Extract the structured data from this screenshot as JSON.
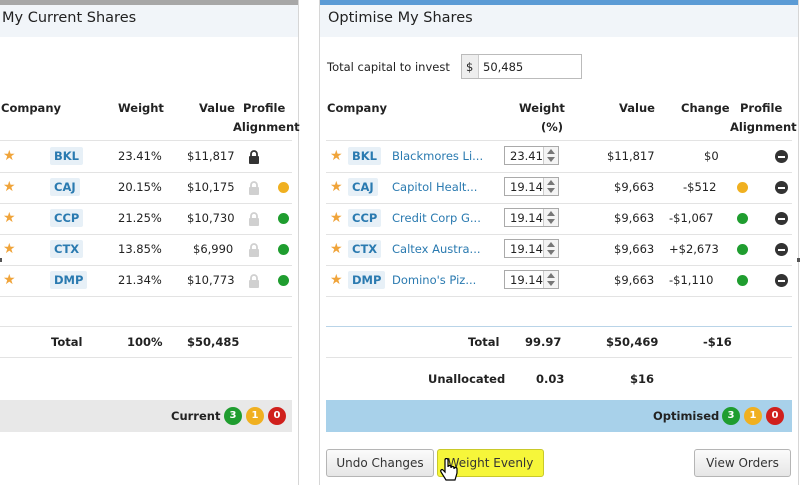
{
  "colors": {
    "green": "#1f9d2f",
    "amber": "#f0b020",
    "red": "#d0201c",
    "star": "#f0a43a",
    "link": "#2a7ab0",
    "summary_bar": "#a8d1ea"
  },
  "current": {
    "title": "My Current Shares",
    "headers": {
      "company": "Company",
      "weight": "Weight",
      "value": "Value",
      "profile1": "Profile",
      "profile2": "Alignment"
    },
    "rows": [
      {
        "code": "BKL",
        "weight": "23.41%",
        "value": "$11,817",
        "lock": "dark",
        "status": "none"
      },
      {
        "code": "CAJ",
        "weight": "20.15%",
        "value": "$10,175",
        "lock": "light",
        "status": "amber"
      },
      {
        "code": "CCP",
        "weight": "21.25%",
        "value": "$10,730",
        "lock": "light",
        "status": "green"
      },
      {
        "code": "CTX",
        "weight": "13.85%",
        "value": "$6,990",
        "lock": "light",
        "status": "green"
      },
      {
        "code": "DMP",
        "weight": "21.34%",
        "value": "$10,773",
        "lock": "light",
        "status": "green"
      }
    ],
    "total": {
      "label": "Total",
      "weight": "100%",
      "value": "$50,485"
    },
    "summary": {
      "label": "Current",
      "green": "3",
      "amber": "1",
      "red": "0"
    }
  },
  "optimise": {
    "title": "Optimise My Shares",
    "capital_label": "Total capital to invest",
    "currency": "$",
    "capital_value": "50,485",
    "headers": {
      "company": "Company",
      "weight1": "Weight",
      "weight2": "(%)",
      "value": "Value",
      "change": "Change",
      "profile1": "Profile",
      "profile2": "Alignment"
    },
    "rows": [
      {
        "code": "BKL",
        "name": "Blackmores Li...",
        "weight": "23.41",
        "value": "$11,817",
        "change": "$0",
        "status": "none"
      },
      {
        "code": "CAJ",
        "name": "Capitol Healt...",
        "weight": "19.14",
        "value": "$9,663",
        "change": "-$512",
        "status": "amber"
      },
      {
        "code": "CCP",
        "name": "Credit Corp G...",
        "weight": "19.14",
        "value": "$9,663",
        "change": "-$1,067",
        "status": "green"
      },
      {
        "code": "CTX",
        "name": "Caltex Austra...",
        "weight": "19.14",
        "value": "$9,663",
        "change": "+$2,673",
        "status": "green"
      },
      {
        "code": "DMP",
        "name": "Domino's Piz...",
        "weight": "19.14",
        "value": "$9,663",
        "change": "-$1,110",
        "status": "green"
      }
    ],
    "total": {
      "label": "Total",
      "weight": "99.97",
      "value": "$50,469",
      "change": "-$16"
    },
    "unallocated": {
      "label": "Unallocated",
      "weight": "0.03",
      "value": "$16"
    },
    "summary": {
      "label": "Optimised",
      "green": "3",
      "amber": "1",
      "red": "0"
    },
    "buttons": {
      "undo": "Undo Changes",
      "weight_evenly": "Weight Evenly",
      "view_orders": "View Orders"
    }
  }
}
